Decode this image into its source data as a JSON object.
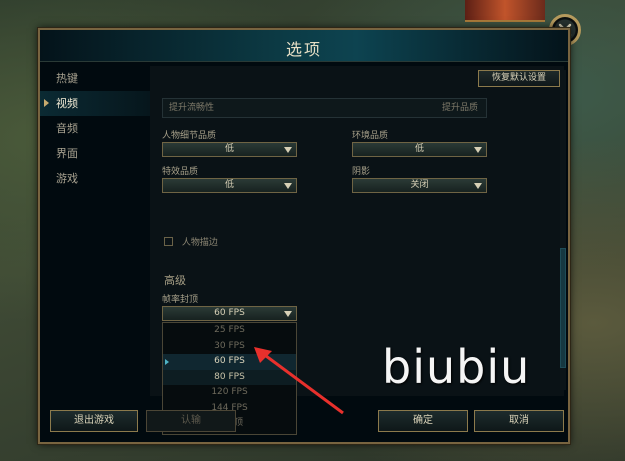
{
  "dialog": {
    "title": "选项",
    "reset_label": "恢复默认设置"
  },
  "sidebar": {
    "items": [
      {
        "label": "热键"
      },
      {
        "label": "视频"
      },
      {
        "label": "音频"
      },
      {
        "label": "界面"
      },
      {
        "label": "游戏"
      }
    ]
  },
  "video": {
    "perf_left": "提升流畅性",
    "perf_right": "提升品质",
    "character_quality": {
      "label": "人物细节品质",
      "value": "低"
    },
    "environment_quality": {
      "label": "环境品质",
      "value": "低"
    },
    "effects_quality": {
      "label": "特效品质",
      "value": "低"
    },
    "shadows": {
      "label": "阴影",
      "value": "关闭"
    },
    "character_inking": {
      "label": "人物描边"
    },
    "advanced_title": "高级",
    "fps_cap": {
      "label": "帧率封顶",
      "value": "60 FPS",
      "options": [
        "25 FPS",
        "30 FPS",
        "60 FPS",
        "80 FPS",
        "120 FPS",
        "144 FPS",
        "不封顶"
      ]
    }
  },
  "footer": {
    "exit_label": "退出游戏",
    "surrender_label": "认输",
    "ok_label": "确定",
    "cancel_label": "取消"
  },
  "overlay": {
    "watermark": "biubiu",
    "arrow_color": "#e8302c"
  },
  "colors": {
    "gold_border": "#786440",
    "accent_teal": "#0d4350"
  }
}
